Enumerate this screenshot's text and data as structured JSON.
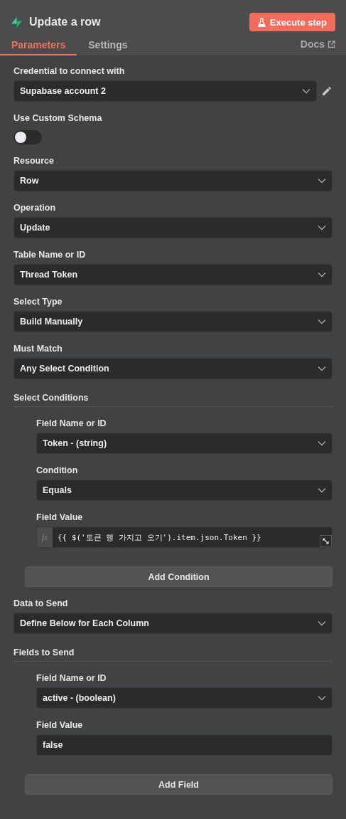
{
  "header": {
    "title": "Update a row",
    "execute_button": "Execute step"
  },
  "tabs": [
    {
      "label": "Parameters",
      "selected": true
    },
    {
      "label": "Settings",
      "selected": false
    }
  ],
  "docs_link": "Docs",
  "parameters": [
    {
      "kind": "select",
      "label": "Credential to connect with",
      "value": "Supabase account 2",
      "editable": true
    },
    {
      "kind": "toggle",
      "label": "Use Custom Schema",
      "on": false
    },
    {
      "kind": "select",
      "label": "Resource",
      "value": "Row"
    },
    {
      "kind": "select",
      "label": "Operation",
      "value": "Update"
    },
    {
      "kind": "select",
      "label": "Table Name or ID",
      "value": "Thread Token"
    },
    {
      "kind": "select",
      "label": "Select Type",
      "value": "Build Manually"
    },
    {
      "kind": "select",
      "label": "Must Match",
      "value": "Any Select Condition"
    },
    {
      "kind": "collection",
      "label": "Select Conditions",
      "add_button": "Add Condition",
      "items": [
        {
          "kind": "select",
          "label": "Field Name or ID",
          "value": "Token - (string)"
        },
        {
          "kind": "select",
          "label": "Condition",
          "value": "Equals"
        },
        {
          "kind": "expression",
          "label": "Field Value",
          "prefix": "fx",
          "value": "{{ $('토큰 행 가지고 오기').item.json.Token }}"
        }
      ]
    },
    {
      "kind": "select",
      "label": "Data to Send",
      "value": "Define Below for Each Column"
    },
    {
      "kind": "collection",
      "label": "Fields to Send",
      "add_button": "Add Field",
      "items": [
        {
          "kind": "select",
          "label": "Field Name or ID",
          "value": "active - (boolean)"
        },
        {
          "kind": "text",
          "label": "Field Value",
          "value": "false"
        }
      ]
    }
  ]
}
